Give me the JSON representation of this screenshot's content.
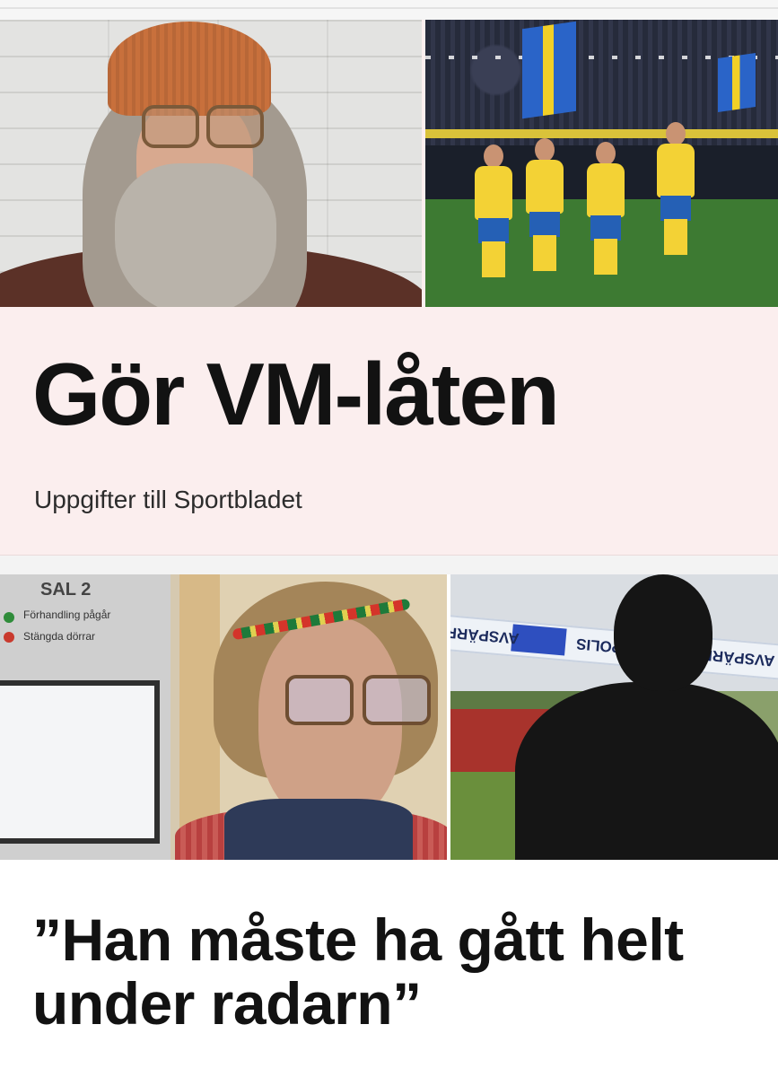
{
  "colors": {
    "card1_bg": "#fbeeee",
    "headline": "#121212"
  },
  "article1": {
    "image_left_alt": "bearded-man-with-beanie-and-glasses",
    "image_right_alt": "swedish-national-team-players-with-flags",
    "headline": "Gör VM-låten",
    "subtitle": "Uppgifter till Sportbladet"
  },
  "article2": {
    "image_left_alt": "man-with-headband-and-glasses-in-courtroom-hallway",
    "image_right_alt": "silhouette-person-behind-police-tape",
    "sign": {
      "title": "SAL 2",
      "line1": "Förhandling pågår",
      "line2": "Stängda dörrar"
    },
    "tape": {
      "left": "AVSPÄRR",
      "middle": "POLIS",
      "right": "AVSPÄRR"
    },
    "headline": "”Han måste ha gått helt under radarn”"
  }
}
